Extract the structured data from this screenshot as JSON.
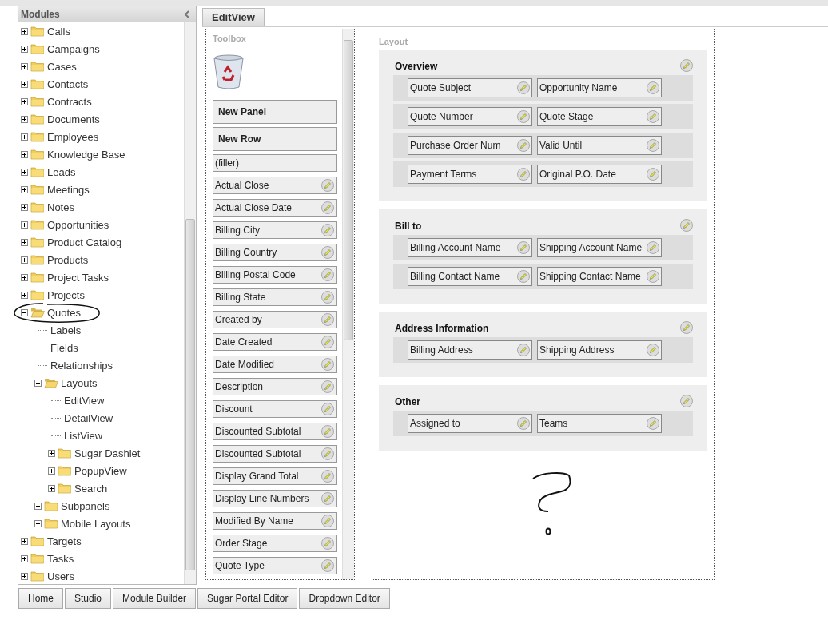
{
  "sidebar": {
    "title": "Modules",
    "items": [
      {
        "kind": "folder",
        "label": "Calls",
        "expanded": false
      },
      {
        "kind": "folder",
        "label": "Campaigns",
        "expanded": false
      },
      {
        "kind": "folder",
        "label": "Cases",
        "expanded": false
      },
      {
        "kind": "folder",
        "label": "Contacts",
        "expanded": false
      },
      {
        "kind": "folder",
        "label": "Contracts",
        "expanded": false
      },
      {
        "kind": "folder",
        "label": "Documents",
        "expanded": false
      },
      {
        "kind": "folder",
        "label": "Employees",
        "expanded": false
      },
      {
        "kind": "folder",
        "label": "Knowledge Base",
        "expanded": false
      },
      {
        "kind": "folder",
        "label": "Leads",
        "expanded": false
      },
      {
        "kind": "folder",
        "label": "Meetings",
        "expanded": false
      },
      {
        "kind": "folder",
        "label": "Notes",
        "expanded": false
      },
      {
        "kind": "folder",
        "label": "Opportunities",
        "expanded": false
      },
      {
        "kind": "folder",
        "label": "Product Catalog",
        "expanded": false
      },
      {
        "kind": "folder",
        "label": "Products",
        "expanded": false
      },
      {
        "kind": "folder",
        "label": "Project Tasks",
        "expanded": false
      },
      {
        "kind": "folder",
        "label": "Projects",
        "expanded": false
      },
      {
        "kind": "folder",
        "label": "Quotes",
        "expanded": true,
        "circled": true,
        "children": [
          {
            "kind": "leaf",
            "label": "Labels"
          },
          {
            "kind": "leaf",
            "label": "Fields"
          },
          {
            "kind": "leaf",
            "label": "Relationships"
          },
          {
            "kind": "folder",
            "label": "Layouts",
            "expanded": true,
            "children": [
              {
                "kind": "leaf",
                "label": "EditView"
              },
              {
                "kind": "leaf",
                "label": "DetailView"
              },
              {
                "kind": "leaf",
                "label": "ListView"
              },
              {
                "kind": "folder",
                "label": "Sugar Dashlet",
                "expanded": false
              },
              {
                "kind": "folder",
                "label": "PopupView",
                "expanded": false
              },
              {
                "kind": "folder",
                "label": "Search",
                "expanded": false
              }
            ]
          },
          {
            "kind": "folder",
            "label": "Subpanels",
            "expanded": false
          },
          {
            "kind": "folder",
            "label": "Mobile Layouts",
            "expanded": false
          }
        ]
      },
      {
        "kind": "folder",
        "label": "Targets",
        "expanded": false
      },
      {
        "kind": "folder",
        "label": "Tasks",
        "expanded": false
      },
      {
        "kind": "folder",
        "label": "Users",
        "expanded": false
      }
    ]
  },
  "tabs": [
    {
      "label": "EditView",
      "selected": true
    }
  ],
  "toolbox": {
    "title": "Toolbox",
    "items": [
      {
        "kind": "panel",
        "label": "New Panel"
      },
      {
        "kind": "row",
        "label": "New Row"
      },
      {
        "kind": "filler",
        "label": "(filler)"
      },
      {
        "kind": "field",
        "label": "Actual Close"
      },
      {
        "kind": "field",
        "label": "Actual Close Date"
      },
      {
        "kind": "field",
        "label": "Billing City"
      },
      {
        "kind": "field",
        "label": "Billing Country"
      },
      {
        "kind": "field",
        "label": "Billing Postal Code"
      },
      {
        "kind": "field",
        "label": "Billing State"
      },
      {
        "kind": "field",
        "label": "Created by"
      },
      {
        "kind": "field",
        "label": "Date Created"
      },
      {
        "kind": "field",
        "label": "Date Modified"
      },
      {
        "kind": "field",
        "label": "Description"
      },
      {
        "kind": "field",
        "label": "Discount"
      },
      {
        "kind": "field",
        "label": "Discounted Subtotal"
      },
      {
        "kind": "field",
        "label": "Discounted Subtotal"
      },
      {
        "kind": "field",
        "label": "Display Grand Total"
      },
      {
        "kind": "field",
        "label": "Display Line Numbers"
      },
      {
        "kind": "field",
        "label": "Modified By Name"
      },
      {
        "kind": "field",
        "label": "Order Stage"
      },
      {
        "kind": "field",
        "label": "Quote Type"
      }
    ]
  },
  "layout": {
    "title": "Layout",
    "panels": [
      {
        "title": "Overview",
        "rows": [
          {
            "fields": [
              "Quote Subject",
              "Opportunity Name"
            ]
          },
          {
            "fields": [
              "Quote Number",
              "Quote Stage"
            ]
          },
          {
            "fields": [
              "Purchase Order Num",
              "Valid Until"
            ]
          },
          {
            "fields": [
              "Payment Terms",
              "Original P.O. Date"
            ]
          }
        ]
      },
      {
        "title": "Bill to",
        "rows": [
          {
            "fields": [
              "Billing Account Name",
              "Shipping Account Name"
            ]
          },
          {
            "fields": [
              "Billing Contact Name",
              "Shipping Contact Name"
            ]
          }
        ]
      },
      {
        "title": "Address Information",
        "rows": [
          {
            "fields": [
              "Billing Address",
              "Shipping Address"
            ]
          }
        ]
      },
      {
        "title": "Other",
        "rows": [
          {
            "fields": [
              "Assigned to",
              "Teams"
            ]
          }
        ]
      }
    ]
  },
  "footer_tabs": [
    "Home",
    "Studio",
    "Module Builder",
    "Sugar Portal Editor",
    "Dropdown Editor"
  ]
}
